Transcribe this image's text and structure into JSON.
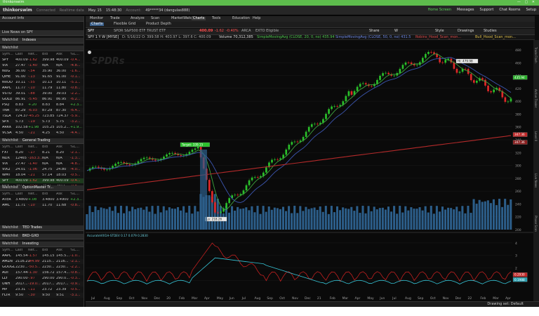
{
  "window": {
    "title": "thinkorswim",
    "controls": "— ▢ ✕"
  },
  "topbar": {
    "logo": "thinkorswim",
    "connection": "Connected",
    "data_status": "Realtime data",
    "date": "May. 15",
    "time": "15:48:30",
    "account_label": "Account:",
    "account": "49*****34 (dangulas888)",
    "right_links": [
      {
        "label": "Home Screen",
        "green": true
      },
      {
        "label": "Messages",
        "green": false
      },
      {
        "label": "Support",
        "green": false
      },
      {
        "label": "Chat Rooms",
        "green": false
      },
      {
        "label": "Setup",
        "green": false
      }
    ],
    "ondemand": "OnDemand"
  },
  "topnav": [
    "Monitor",
    "Trade",
    "Analyze",
    "Scan",
    "MarketWatch",
    "Charts",
    "Tools",
    "Education",
    "Help"
  ],
  "tabs": [
    "Charts",
    "Flexible Grid",
    "Product Depth"
  ],
  "sidebar": {
    "account_info": "Account Info",
    "live_news": "Live News on SPY",
    "col_headers": [
      "Sym...",
      "Last",
      "Net...",
      "Bid",
      "Ask",
      "%C..."
    ],
    "watch1": {
      "title": "Watchlist",
      "name": "Indexes",
      "name2": "Watchlist"
    },
    "watch1_rows": [
      {
        "sym": "SPY",
        "last": "400.09",
        "net": "-1.62",
        "bid": "399.98",
        "ask": "400.09",
        "pct": "-0.4...",
        "dir": "dn"
      },
      {
        "sym": "VIX",
        "last": "27.47",
        "net": "-1.40",
        "bid": "N/A",
        "ask": "N/A",
        "pct": "-4.8...",
        "dir": "dn"
      },
      {
        "sym": "NUG",
        "last": "36.00",
        "net": "-.54",
        "bid": "35.90",
        "ask": "36.00",
        "pct": "-1.6...",
        "dir": "dn"
      },
      {
        "sym": "QIHE",
        "last": "91.00",
        "net": "-.13",
        "bid": "91.65",
        "ask": "91.00",
        "pct": "-0.1...",
        "dir": "dn"
      },
      {
        "sym": "NVDD",
        "last": "10.11",
        "net": "-.55",
        "bid": "10.13",
        "ask": "10.11",
        "pct": "-5.1...",
        "dir": "dn"
      },
      {
        "sym": "AAPL",
        "last": "11.77",
        "net": "-.10",
        "bid": "11.79",
        "ask": "11.80",
        "pct": "-0.8...",
        "dir": "dn"
      },
      {
        "sym": "VSTO",
        "last": "39.01",
        "net": "-.88",
        "bid": "39.00",
        "ask": "39.03",
        "pct": "-2.2...",
        "dir": "dn"
      },
      {
        "sym": "GOLD",
        "last": "86.91",
        "net": "-5.45",
        "bid": "86.91",
        "ask": "86.95",
        "pct": "-6.2...",
        "dir": "dn"
      },
      {
        "sym": "PSQ",
        "last": "8.83",
        "net": "+.20",
        "bid": "8.83",
        "ask": "8.84",
        "pct": "+2.3...",
        "dir": "up"
      },
      {
        "sym": "TNA",
        "last": "87.29",
        "net": "-6.03",
        "bid": "87.29",
        "ask": "87.30",
        "pct": "-6.4...",
        "dir": "dn"
      },
      {
        "sym": "TSLA",
        "last": "724.37",
        "net": "-45.25",
        "bid": "723.85",
        "ask": "724.37",
        "pct": "-5.9...",
        "dir": "dn"
      },
      {
        "sym": "SPX",
        "last": "5.73",
        "net": "-.19",
        "bid": "5.73",
        "ask": "5.75",
        "pct": "-3.2...",
        "dir": "dn"
      },
      {
        "sym": "ARKK",
        "last": "102.58",
        "net": "+1.98",
        "bid": "105.25",
        "ask": "105.2...",
        "pct": "+1.9...",
        "dir": "up"
      },
      {
        "sym": "VCSA",
        "last": "4.50",
        "net": "-.21",
        "bid": "4.25",
        "ask": "4.50",
        "pct": "-4.4...",
        "dir": "dn"
      }
    ],
    "watch2": {
      "title": "Watchlist",
      "name": "General Trading"
    },
    "watch2_rows": [
      {
        "sym": "FXT",
        "last": "8.20",
        "net": "-.17",
        "bid": "8.21",
        "ask": "8.20",
        "pct": "-2.1...",
        "dir": "dn"
      },
      {
        "sym": "NDX",
        "last": "12465",
        "net": "-163.3...",
        "bid": "N/A",
        "ask": "N/A",
        "pct": "-1.3...",
        "dir": "dn"
      },
      {
        "sym": "VIX",
        "last": "27.47",
        "net": "-1.40",
        "bid": "N/A",
        "ask": "N/A",
        "pct": "-4.8...",
        "dir": "dn"
      },
      {
        "sym": "VIX2",
        "last": "24.01",
        "net": "-1.06",
        "bid": "24.75",
        "ask": "24.80",
        "pct": "-4.0...",
        "dir": "dn"
      },
      {
        "sym": "WMT",
        "last": "18.04",
        "net": "-.21",
        "bid": "57.14",
        "ask": "18.03",
        "pct": "-0.5...",
        "dir": "dn"
      },
      {
        "sym": "SPY",
        "last": "400.09",
        "net": "-1.62",
        "bid": "399.98",
        "ask": "400.09",
        "pct": "-0.4...",
        "dir": "dn",
        "hl": true
      },
      {
        "sym": "SILK",
        "last": "2417...",
        "net": "-19.0...",
        "bid": "2421...",
        "ask": "2417...",
        "pct": "-0.8...",
        "dir": "dn"
      }
    ],
    "watch3": {
      "title": "Watchlist",
      "name": "OptionMaster Tr..."
    },
    "watch3_rows": [
      {
        "sym": "ATER",
        "last": "3.4800",
        "net": "+.08",
        "bid": "3.4800",
        "ask": "3.4900",
        "pct": "+2.3...",
        "dir": "up"
      },
      {
        "sym": "AMC",
        "last": "11.71",
        "net": "-.10",
        "bid": "11.70",
        "ask": "11.68",
        "pct": "-0.8...",
        "dir": "dn"
      }
    ],
    "watch4": {
      "title": "Watchlist",
      "name": "TED Trades"
    },
    "watch5": {
      "title": "Watchlist",
      "name": "BKO-GXO"
    },
    "watch6": {
      "title": "Watchlist",
      "name": "Investing"
    },
    "watch6_rows": [
      {
        "sym": "AAPL",
        "last": "145.54",
        "net": "-1.57",
        "bid": "145.15",
        "ask": "145.5...",
        "pct": "-1.0...",
        "dir": "dn"
      },
      {
        "sym": "AMZN",
        "last": "2116.21",
        "net": "-44.99",
        "bid": "2115...",
        "ask": "2116...",
        "pct": "-2.1...",
        "dir": "dn"
      },
      {
        "sym": "GOOGL",
        "last": "2230...",
        "net": "-50.5...",
        "bid": "2230...",
        "ask": "2230...",
        "pct": "-2.2...",
        "dir": "dn"
      },
      {
        "sym": "ADI",
        "last": "157.44",
        "net": "-1.30",
        "bid": "156.72",
        "ask": "157.4...",
        "pct": "-0.8...",
        "dir": "dn"
      },
      {
        "sym": "LLY",
        "last": "290.00",
        "net": "-.97",
        "bid": "290.00",
        "ask": "290.0...",
        "pct": "-0.3...",
        "dir": "dn"
      },
      {
        "sym": "UNH",
        "last": "2017...",
        "net": "-19.0...",
        "bid": "2017...",
        "ask": "2017...",
        "pct": "-0.9...",
        "dir": "dn"
      },
      {
        "sym": "MP",
        "last": "23.31",
        "net": "-.11",
        "bid": "23.72",
        "ask": "23.39",
        "pct": "-0.5...",
        "dir": "dn"
      },
      {
        "sym": "FLTR",
        "last": "9.50",
        "net": "-.30",
        "bid": "9.50",
        "ask": "9.51",
        "pct": "-3.1...",
        "dir": "dn"
      }
    ]
  },
  "chart_header": {
    "symbol": "SPY",
    "description": "SPDR S&P500 ETF TRUST ETF",
    "price": "400.09",
    "change": "-1.62",
    "pct": "-0.40%",
    "exchange": "ARCA",
    "ttm": "EXTO Eligible",
    "buttons": [
      "Share",
      "W",
      "Style",
      "Drawings",
      "Studies"
    ]
  },
  "studies_line": {
    "title": "SPY 1 Y W [MYSE]",
    "ohlc": "D: 5/16/22  O: 399.58  H: 403.97  L: 397.6  C: 400.09",
    "volume": "Volume 70,312,385",
    "sma1": "SimpleMovingAvg (CLOSE, 20, 0, no) 435.94",
    "sma2": "SimpleMovingAvg (CLOSE, 50, 0, no) 431.5",
    "sma3": "SimpleMovingAvg (CLOSE, 200, 0, no)",
    "extra": "Robins_Hood_Scan_mon...",
    "extra2": "Bull_Hood_Scan_mon..."
  },
  "chart": {
    "price_axis": [
      "480",
      "460",
      "440",
      "420",
      "400",
      "380",
      "360",
      "340",
      "320",
      "300",
      "280",
      "260",
      "240",
      "220",
      "200"
    ],
    "badges": {
      "high_label": "Hi: 479.98",
      "low_label": "Lo: 218.26",
      "target_label": "Target: 339.15",
      "price_badge": "400.09",
      "green_badge": "435.94",
      "red_badge": "347.36",
      "red_badge2": "347.36"
    },
    "lower_axis": [
      "4",
      "3",
      "2",
      "1"
    ],
    "lower_badges": {
      "red": "0.2930",
      "cyan": "0.1988"
    },
    "time_labels": [
      "Jul",
      "Aug",
      "Sep",
      "Oct",
      "Nov",
      "Dec",
      "20",
      "Feb",
      "Mar",
      "Apr",
      "May",
      "Jun",
      "Jul",
      "Aug",
      "Sep",
      "Oct",
      "Nov",
      "Dec",
      "21",
      "Feb",
      "Mar",
      "Apr",
      "May",
      "Jun",
      "Jul",
      "Aug",
      "Sep",
      "Oct",
      "Nov",
      "Dec",
      "22",
      "Feb",
      "Mar",
      "Apr"
    ],
    "lower_study": "AccurateVIX1H-STDEV  0.17 0.079  0.2830"
  },
  "chart_colors": {
    "green": "#2ac02a",
    "red": "#e02828",
    "sma20": "#3ea63e",
    "sma50": "#3c56b0",
    "sma200": "#b32a2a",
    "volume": "#2c5e8a",
    "cyan": "#36c4d6"
  },
  "right_tabs": [
    "Trade Flash",
    "Active Trader",
    "Level II",
    "Live News",
    "Phase Scan"
  ],
  "bottom_bar": {
    "drawing_set": "Drawing set: Default"
  }
}
